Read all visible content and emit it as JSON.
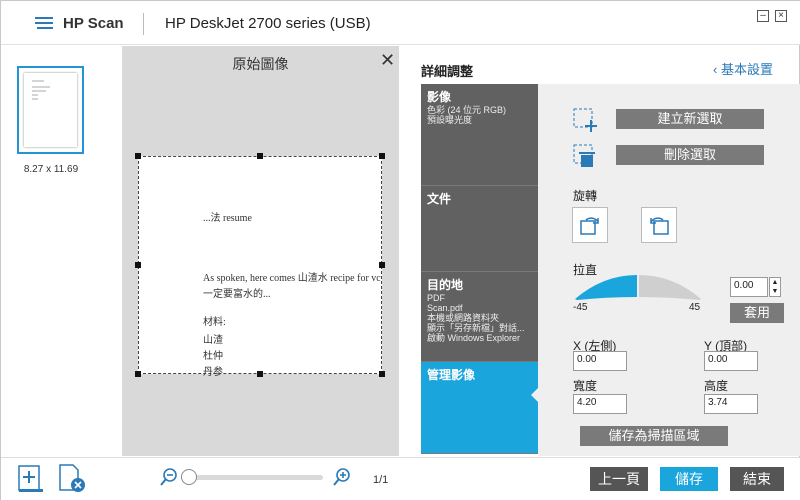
{
  "titlebar": {
    "app_name": "HP Scan",
    "device_name": "HP DeskJet 2700 series (USB)"
  },
  "thumbnail": {
    "page_size": "8.27 x 11.69"
  },
  "preview": {
    "title": "原始圖像",
    "doc_lines": [
      "...法 resume",
      "As spoken, here comes  山渣水 recipe for vc",
      "一定要富水的...",
      "材料:",
      "山渣",
      "杜仲",
      "丹参"
    ]
  },
  "panel": {
    "heading": "詳細調整",
    "basic_link": "基本設置"
  },
  "nav": {
    "image": {
      "title": "影像",
      "sub": [
        "色彩 (24 位元 RGB)",
        "預設曝光度"
      ]
    },
    "document": {
      "title": "文件"
    },
    "destination": {
      "title": "目的地",
      "sub": [
        "PDF",
        "Scan.pdf",
        "本機或網路資料夾",
        "顯示「另存新檔」對話...",
        "啟動 Windows Explorer"
      ]
    },
    "manage": {
      "title": "管理影像"
    }
  },
  "manage": {
    "new_selection": "建立新選取",
    "delete_selection": "刪除選取",
    "rotate_label": "旋轉",
    "straighten_label": "拉直",
    "straighten_min": "-45",
    "straighten_max": "45",
    "straighten_value": "0.00",
    "apply_label": "套用",
    "x_label": "X (左側)",
    "y_label": "Y (頂部)",
    "x_value": "0.00",
    "y_value": "0.00",
    "width_label": "寬度",
    "height_label": "高度",
    "width_value": "4.20",
    "height_value": "3.74",
    "save_area": "儲存為掃描區域"
  },
  "footer": {
    "page_count": "1/1",
    "prev": "上一頁",
    "save": "儲存",
    "finish": "結束"
  },
  "colors": {
    "accent": "#1aa5dd",
    "nav_gray": "#616161",
    "button_gray": "#7a7a7a",
    "footer_btn": "#555555"
  }
}
